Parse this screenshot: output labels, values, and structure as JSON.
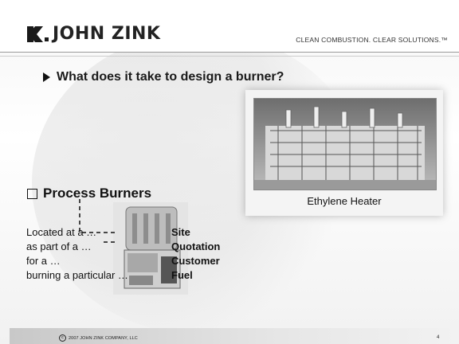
{
  "header": {
    "logo_text": "JOHN ZINK",
    "tagline": "CLEAN COMBUSTION. CLEAR SOLUTIONS.™"
  },
  "main": {
    "bullet": "What does it take to design a burner?",
    "photo_caption": "Ethylene Heater",
    "process_burners": "Process Burners",
    "left_lines": [
      "Located at a …",
      "as part of a …",
      "for a …",
      "burning a particular …"
    ],
    "right_lines": [
      "Site",
      "Quotation",
      "Customer",
      "Fuel"
    ]
  },
  "footer": {
    "copyright": "2007 JOHN ZINK COMPANY, LLC",
    "page_number": "4"
  },
  "colors": {
    "text": "#111111",
    "logo_accent": "#1a1a1a"
  }
}
